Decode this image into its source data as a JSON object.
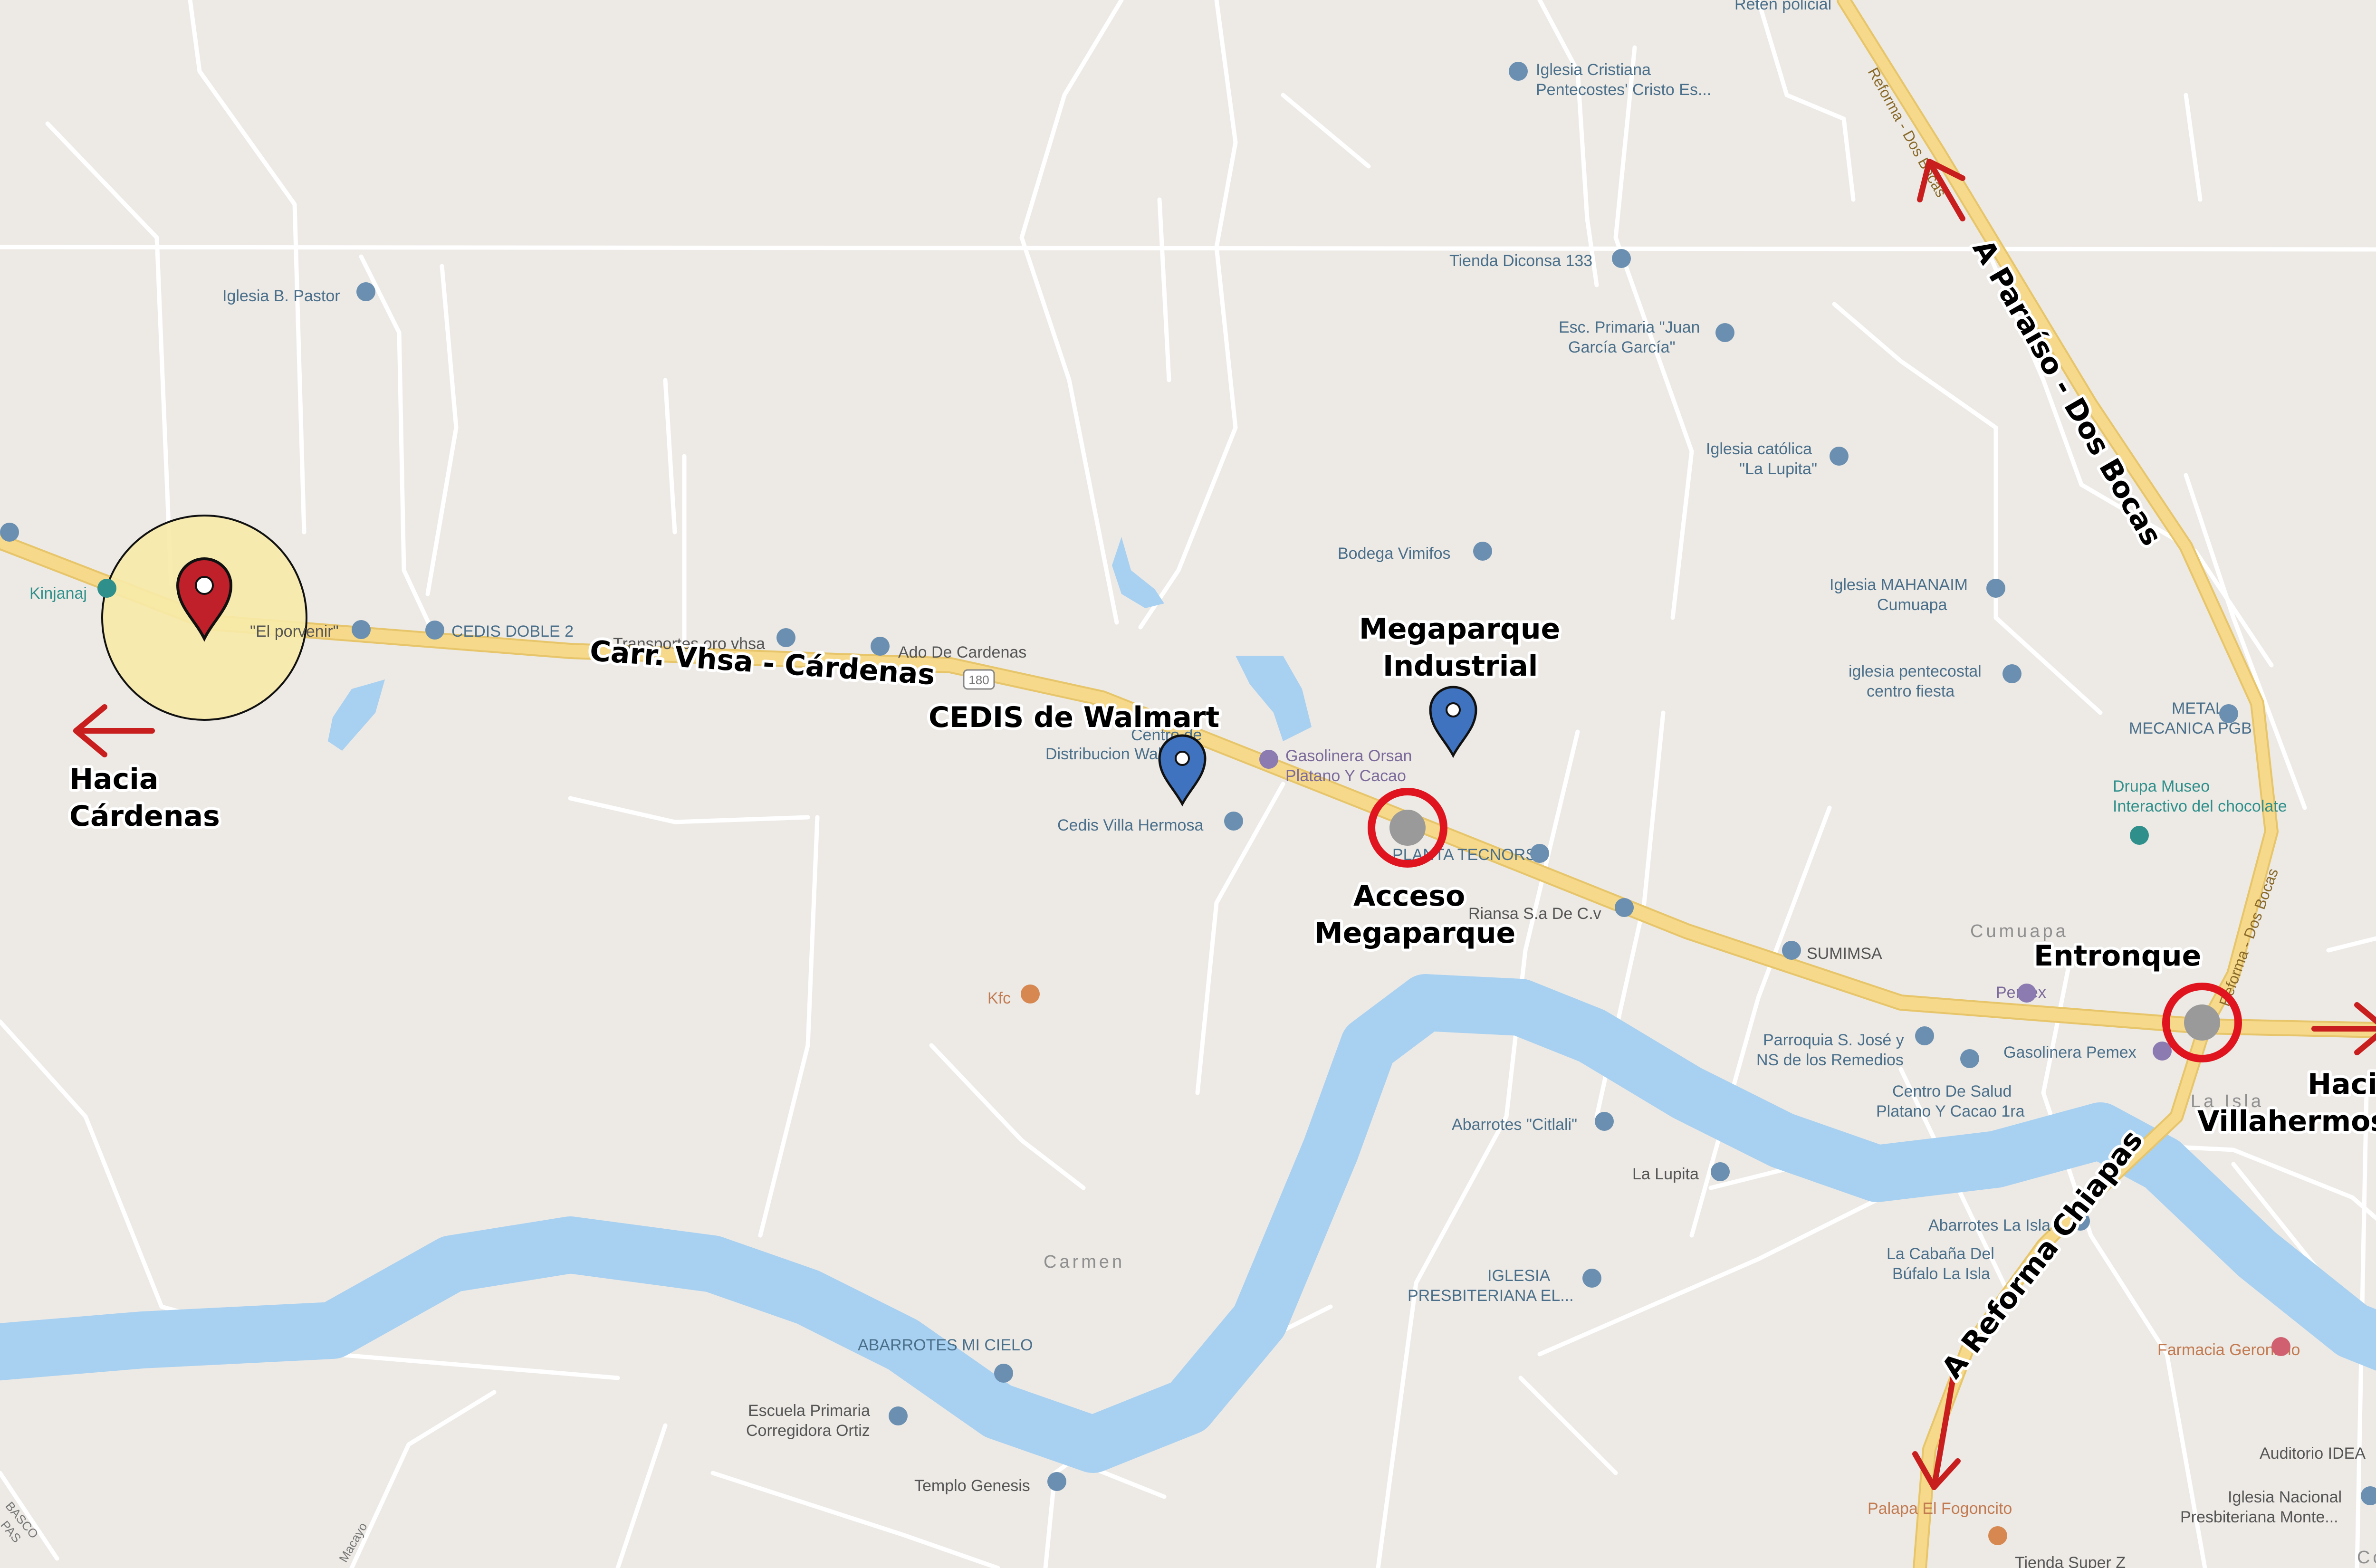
{
  "map": {
    "roads": {
      "highway_label": "Carr. Vhsa - Cárdenas",
      "highway_number": "180",
      "reforma_dos_bocas_label": "Reforma - Dos Bocas"
    },
    "annotations": {
      "hacia_cardenas_1": "Hacia",
      "hacia_cardenas_2": "Cárdenas",
      "cedis_walmart": "CEDIS de Walmart",
      "megaparque_1": "Megaparque",
      "megaparque_2": "Industrial",
      "acceso_1": "Acceso",
      "acceso_2": "Megaparque",
      "entronque": "Entronque",
      "hacia_vhsa_1": "Hacia",
      "hacia_vhsa_2": "Villahermosa",
      "a_paraiso": "A Paraíso - Dos Bocas",
      "a_reforma": "A Reforma Chiapas"
    },
    "places": {
      "reten": "Reten policial",
      "iglesia_cristiana_1": "Iglesia Cristiana",
      "iglesia_cristiana_2": "Pentecostes' Cristo Es...",
      "tienda_diconsa": "Tienda Diconsa 133",
      "esc_primaria_1": "Esc. Primaria \"Juan",
      "esc_primaria_2": "García García\"",
      "iglesia_catolica_1": "Iglesia católica",
      "iglesia_catolica_2": "\"La Lupita\"",
      "iglesia_pastor": "Iglesia B. Pastor",
      "kinjanaj": "Kinjanaj",
      "el_porvenir": "\"El porvenir\"",
      "cedis_doble": "CEDIS DOBLE 2",
      "transportes": "Transportes oro vhsa",
      "ado": "Ado De Cardenas",
      "bodega_vimifos": "Bodega Vimifos",
      "iglesia_mahanaim_1": "Iglesia MAHANAIM",
      "iglesia_mahanaim_2": "Cumuapa",
      "iglesia_pentecostal_1": "iglesia pentecostal",
      "iglesia_pentecostal_2": "centro fiesta",
      "metal_1": "METAL",
      "metal_2": "MECANICA PGB",
      "drupa_1": "Drupa Museo",
      "drupa_2": "Interactivo del chocolate",
      "centro_dist_1": "Centro de",
      "centro_dist_2": "Distribucion Walmart",
      "gasolinera_orsan_1": "Gasolinera Orsan",
      "gasolinera_orsan_2": "Platano Y Cacao",
      "cedis_villa": "Cedis Villa Hermosa",
      "planta": "PLANTA TECNORSA",
      "riansa": "Riansa S.a De C.v",
      "sumimsa": "SUMIMSA",
      "cumuapa": "Cumuapa",
      "pemex": "Pemex",
      "kfc": "Kfc",
      "parroquia_1": "Parroquia S. José y",
      "parroquia_2": "NS de los Remedios",
      "gasolinera_pemex": "Gasolinera Pemex",
      "la_isla": "La Isla",
      "centro_salud_1": "Centro De Salud",
      "centro_salud_2": "Platano Y Cacao 1ra",
      "abarrotes_citlali": "Abarrotes \"Citlali\"",
      "la_lupita": "La Lupita",
      "abarrotes_la_isla": "Abarrotes La Isla",
      "cabana_1": "La Cabaña Del",
      "cabana_2": "Búfalo La Isla",
      "carmen": "Carmen",
      "iglesia_presb_1": "IGLESIA",
      "iglesia_presb_2": "PRESBITERIANA EL...",
      "abarrotes_mi_cielo": "ABARROTES MI CIELO",
      "farmacia": "Farmacia Geronimo",
      "escuela_1": "Escuela Primaria",
      "escuela_2": "Corregidora Ortiz",
      "templo_genesis": "Templo Genesis",
      "palapa": "Palapa El Fogoncito",
      "auditorio": "Auditorio IDEA",
      "iglesia_nacional_1": "Iglesia Nacional",
      "iglesia_nacional_2": "Presbiteriana Monte...",
      "corregidora": "Corregi",
      "tienda_super": "Tienda Super Z",
      "tabasco_1": "BASCO",
      "tabasco_2": "PAS",
      "macayo": "Macayo"
    },
    "colors": {
      "land": "#edeae6",
      "water": "#a8d0f0",
      "highway": "#f6d98a",
      "minor_road": "#ffffff",
      "red_marker": "#c0202a",
      "blue_marker": "#3f72bf",
      "buffer": "#f7eaa9",
      "ring": "#e0141e",
      "arrow": "#c81e1e"
    }
  }
}
